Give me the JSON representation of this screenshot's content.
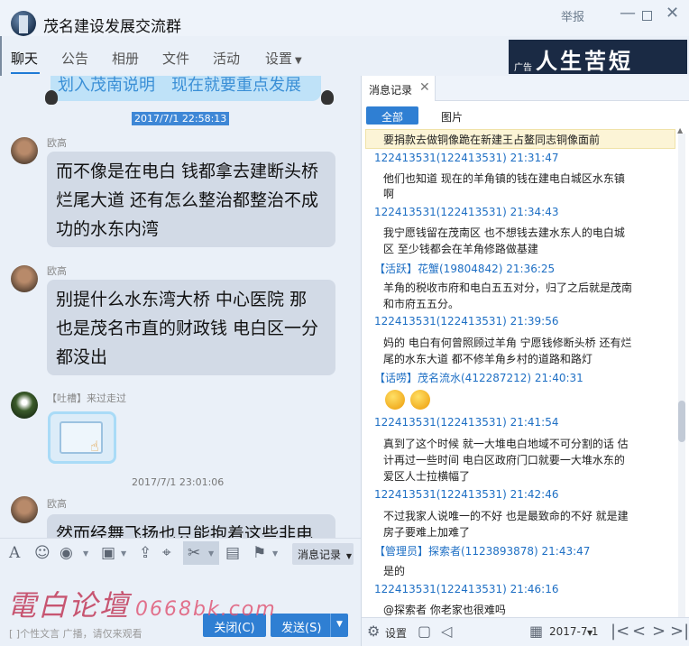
{
  "window": {
    "title": "茂名建设发展交流群",
    "report_label": "举报",
    "minimize_glyph": "—",
    "close_glyph": "✕"
  },
  "tabs": [
    {
      "label": "聊天"
    },
    {
      "label": "公告"
    },
    {
      "label": "相册"
    },
    {
      "label": "文件"
    },
    {
      "label": "活动"
    },
    {
      "label": "设置"
    }
  ],
  "ad": {
    "tag": "广告",
    "text": "人生苦短"
  },
  "chat": {
    "top_message": "划入茂南说明　现在就要重点发展",
    "top_time": "2017/7/1 22:58:13",
    "messages": [
      {
        "sender": "欧高",
        "lines": [
          "而不像是在电白 钱都拿去建断头桥",
          "烂尾大道 还有怎么整治都整治不成",
          "功的水东内湾"
        ]
      },
      {
        "sender": "欧高",
        "lines": [
          "别提什么水东湾大桥 中心医院 那",
          "也是茂名市直的财政钱 电白区一分",
          "都没出"
        ]
      },
      {
        "sender": "【吐槽】来过走过",
        "lines": []
      },
      {
        "sender": "欧高",
        "lines": [
          "然而经舞飞扬也只能抱着这些非电"
        ]
      }
    ],
    "time_2": "2017/7/1 23:01:06"
  },
  "toolbar": {
    "icons": [
      "font-icon",
      "emoji-icon",
      "shake-icon",
      "image-icon",
      "upload-icon",
      "screenshot-icon",
      "clipboard-icon",
      "reply-icon"
    ],
    "history_label": "消息记录"
  },
  "input": {
    "hint": "[ ]个性文言 广播，请仅来观看",
    "send_label": "关闭(C)",
    "send2_label": "发送(S)"
  },
  "panel": {
    "tab_label": "消息记录",
    "filter_all": "全部",
    "filter_images": "图片",
    "highlight_line": "要捐款去做铜像跪在新建王占鳌同志铜像面前",
    "entries": [
      {
        "head": "122413531(122413531) 21:31:47",
        "body": [
          "他们也知道 现在的羊角镇的钱在建电白城区水东镇",
          "啊"
        ]
      },
      {
        "head": "122413531(122413531) 21:34:43",
        "body": [
          "我宁愿钱留在茂南区 也不想钱去建水东人的电白城",
          "区 至少钱都会在羊角修路做基建"
        ]
      },
      {
        "head": "【活跃】花蟹(19804842) 21:36:25",
        "body": [
          "羊角的税收市府和电白五五对分，归了之后就是茂南",
          "和市府五五分。"
        ]
      },
      {
        "head": "122413531(122413531) 21:39:56",
        "body": [
          "妈的 电白有何曾照顾过羊角 宁愿钱修断头桥 还有烂",
          "尾的水东大道 都不修羊角乡村的道路和路灯"
        ]
      },
      {
        "head": "【话唠】茂名流水(412287212) 21:40:31",
        "body": []
      },
      {
        "head": "122413531(122413531) 21:41:54",
        "body": [
          "真到了这个时候 就一大堆电白地域不可分割的话 估",
          "计再过一些时间 电白区政府门口就要一大堆水东的",
          "爱区人士拉横幅了"
        ]
      },
      {
        "head": "122413531(122413531) 21:42:46",
        "body": [
          "不过我家人说唯一的不好 也是最致命的不好 就是建",
          "房子要难上加难了"
        ]
      },
      {
        "head": "【管理员】探索者(1123893878) 21:43:47",
        "body": [
          "是的"
        ]
      },
      {
        "head": "122413531(122413531) 21:46:16",
        "body": [
          "@探索者 你老家也很难吗"
        ]
      }
    ],
    "footer_settings": "设置",
    "footer_date": "2017-7-1"
  },
  "watermark": {
    "text": "電白论壇",
    "url": "0668bk.com"
  }
}
